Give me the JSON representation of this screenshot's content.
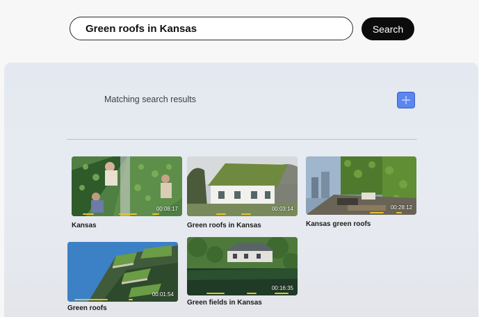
{
  "search": {
    "query": "Green roofs in Kansas",
    "button_label": "Search"
  },
  "results": {
    "heading": "Matching search results",
    "add_icon": "plus-icon",
    "items": [
      {
        "title": "Kansas",
        "duration": "00:08:17"
      },
      {
        "title": "Green roofs in Kansas",
        "duration": "00:03:14"
      },
      {
        "title": "Kansas green roofs",
        "duration": "00:28:12"
      },
      {
        "title": "Green roofs",
        "duration": "00:01:54"
      },
      {
        "title": "Green fields in Kansas",
        "duration": "00:16:35"
      }
    ]
  },
  "colors": {
    "accent": "#5b85f0",
    "button_dark": "#0c0c0c",
    "progress_marker": "#e8c22a"
  }
}
